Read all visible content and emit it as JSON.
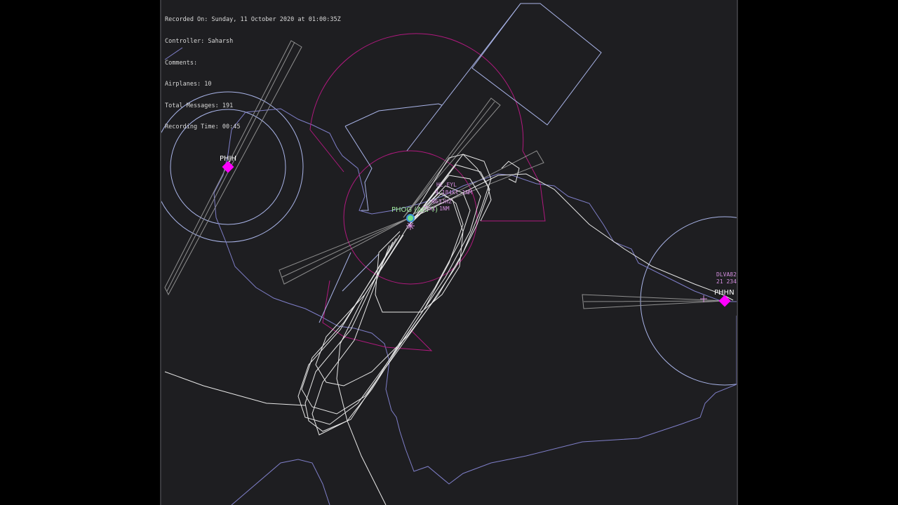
{
  "info": {
    "recorded_on": "Recorded On: Sunday, 11 October 2020 at 01:00:35Z",
    "controller": "Controller: Saharsh",
    "comments": "Comments:",
    "airplanes": "Airplanes: 10",
    "total_messages": "Total Messages: 191",
    "recording_time": "Recording Time: 00:45"
  },
  "airports": {
    "phjh": "PHJH",
    "phog": "PHOG (ARPT)",
    "phhn": "PHHN"
  },
  "aircraft_tags": {
    "tag1_line1": "DLVA82",
    "tag1_line2": "21 234",
    "tag2_line1": "HL EYL",
    "tag2_line2": "9 184kt 1NM",
    "tag3_line1": "N63JHZ",
    "tag3_line2": "78kt 1NM"
  },
  "colors": {
    "background": "#1e1e21",
    "range_ring": "#a9b4e8",
    "coastline": "#7f7fc9",
    "airspace": "#b0197e",
    "runway_extension": "#bdbdbd",
    "track": "#e8e8e8",
    "airport_marker": "#ff00ff",
    "aircraft_tag": "#d58fe0",
    "main_airport_label": "#9ee79a"
  }
}
